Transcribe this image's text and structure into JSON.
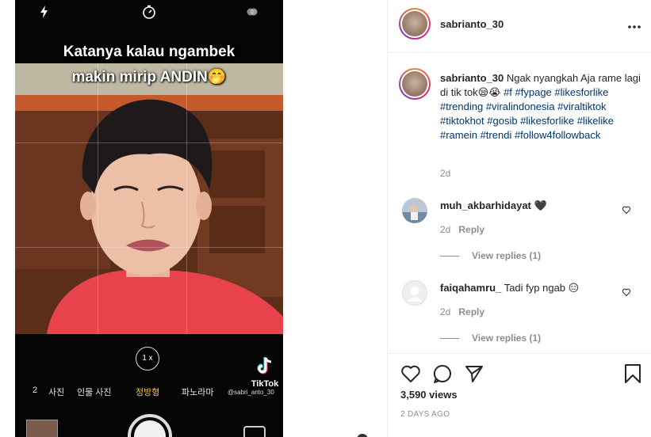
{
  "post": {
    "username": "sabrianto_30",
    "more_label": "•••"
  },
  "media": {
    "overlay_line1": "Katanya kalau ngambek",
    "overlay_line2": "makin mirip ANDIN🤭",
    "zoom_label": "1 x",
    "modes": [
      "사진",
      "인물 사진",
      "정방형",
      "파노라마"
    ],
    "mode_prefix": "2",
    "active_mode": "정방형",
    "tiktok_word": "TikTok",
    "tiktok_user": "@sabri_anto_30"
  },
  "caption": {
    "username": "sabrianto_30",
    "text": "Ngak nyangkah Aja rame lagi di tik tok😪😭",
    "hashtags_line1": "#f #fypage",
    "hashtags_rest": "#likesforlike #trending #viralindonesia #viraltiktok #tiktokhot #gosib #likesforlike #likelike #ramein #trendi #follow4followback",
    "time": "2d"
  },
  "comments": [
    {
      "username": "muh_akbarhidayat",
      "text": "🖤",
      "time": "2d",
      "reply_label": "Reply",
      "view_replies": "View replies (1)"
    },
    {
      "username": "faiqahamru_",
      "text": "Tadi fyp ngab 😑",
      "time": "2d",
      "reply_label": "Reply",
      "view_replies": "View replies (1)"
    }
  ],
  "footer": {
    "views": "3,590 views",
    "date": "2 DAYS AGO"
  },
  "icons": {
    "flash": "flash-icon",
    "timer": "timer-icon",
    "filter": "filter-icon",
    "more": "more-icon",
    "like": "heart-icon",
    "comment": "comment-icon",
    "share": "share-icon",
    "save": "bookmark-icon"
  }
}
